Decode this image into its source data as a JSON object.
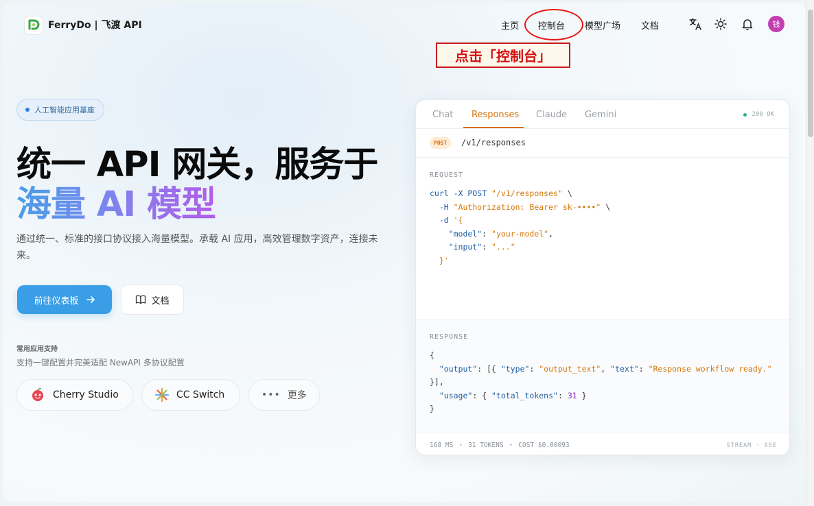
{
  "nav": {
    "brand": "FerryDo | 飞渡 API",
    "links": [
      "主页",
      "控制台",
      "模型广场",
      "文档"
    ],
    "avatar_text": "钱",
    "icons": [
      "translate-icon",
      "sun-icon",
      "bell-icon"
    ]
  },
  "annotation": {
    "callout": "点击「控制台」",
    "color": "#e11111"
  },
  "hero": {
    "badge": "人工智能应用基座",
    "title_line1": "统一 API 网关，服务于",
    "title_line2": "海量 AI 模型",
    "description": "通过统一、标准的接口协议接入海量模型。承载 AI 应用，高效管理数字资产，连接未来。",
    "primary_button": "前往仪表板",
    "secondary_button": "文档"
  },
  "apps": {
    "title": "常用应用支持",
    "subtitle": "支持一键配置并完美适配 NewAPI 多协议配置",
    "items": [
      "Cherry Studio",
      "CC Switch",
      "更多"
    ]
  },
  "code_card": {
    "tabs": [
      "Chat",
      "Responses",
      "Claude",
      "Gemini"
    ],
    "active_tab": "Responses",
    "status": "200 OK",
    "method": "POST",
    "path": "/v1/responses",
    "request_label": "REQUEST",
    "response_label": "RESPONSE",
    "footer": {
      "latency": "168 MS",
      "tokens": "31 TOKENS",
      "cost": "COST $0.00093",
      "mode": "STREAM · SSE"
    }
  },
  "colors": {
    "accent": "#3a9ee6",
    "tab_active": "#d9700a",
    "status_ok": "#1fb877"
  }
}
